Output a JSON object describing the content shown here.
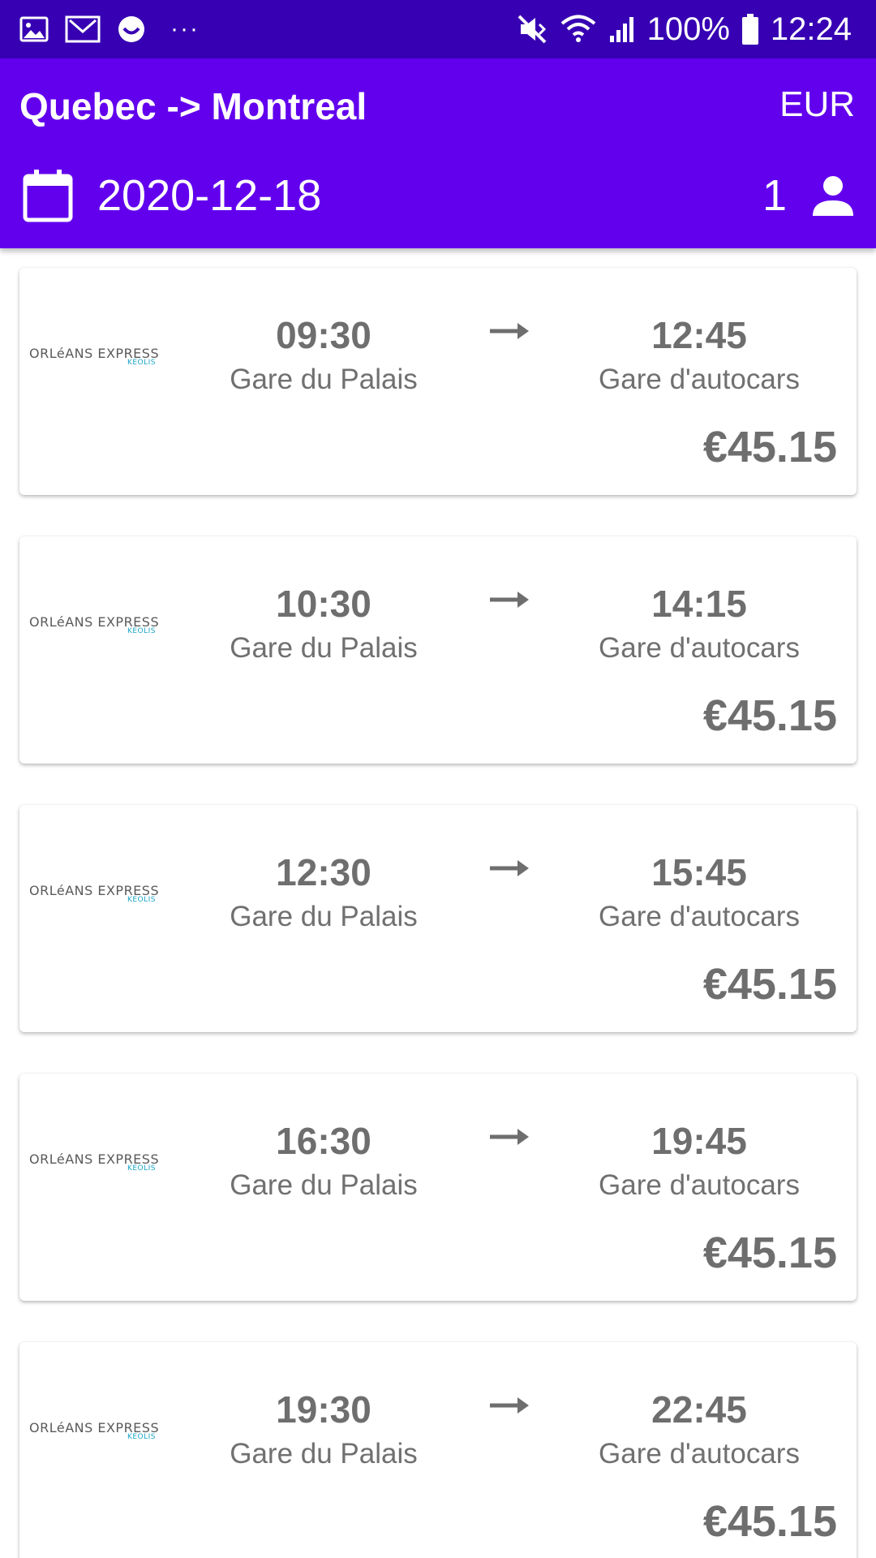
{
  "status_bar": {
    "battery": "100%",
    "time": "12:24",
    "more": "···"
  },
  "header": {
    "route": "Quebec -> Montreal",
    "currency": "EUR",
    "date": "2020-12-18",
    "passengers": "1"
  },
  "trips": [
    {
      "operator": "ORLéANS EXPRESS",
      "operator_sub": "KEOLIS",
      "dep_time": "09:30",
      "dep_station": "Gare du Palais",
      "arr_time": "12:45",
      "arr_station": "Gare d'autocars",
      "price": "€45.15"
    },
    {
      "operator": "ORLéANS EXPRESS",
      "operator_sub": "KEOLIS",
      "dep_time": "10:30",
      "dep_station": "Gare du Palais",
      "arr_time": "14:15",
      "arr_station": "Gare d'autocars",
      "price": "€45.15"
    },
    {
      "operator": "ORLéANS EXPRESS",
      "operator_sub": "KEOLIS",
      "dep_time": "12:30",
      "dep_station": "Gare du Palais",
      "arr_time": "15:45",
      "arr_station": "Gare d'autocars",
      "price": "€45.15"
    },
    {
      "operator": "ORLéANS EXPRESS",
      "operator_sub": "KEOLIS",
      "dep_time": "16:30",
      "dep_station": "Gare du Palais",
      "arr_time": "19:45",
      "arr_station": "Gare d'autocars",
      "price": "€45.15"
    },
    {
      "operator": "ORLéANS EXPRESS",
      "operator_sub": "KEOLIS",
      "dep_time": "19:30",
      "dep_station": "Gare du Palais",
      "arr_time": "22:45",
      "arr_station": "Gare d'autocars",
      "price": "€45.15"
    }
  ],
  "colors": {
    "status_bar": "#3700b3",
    "app_bar": "#6200ee",
    "text_gray": "#707070",
    "logo_accent": "#1aa6c9"
  }
}
